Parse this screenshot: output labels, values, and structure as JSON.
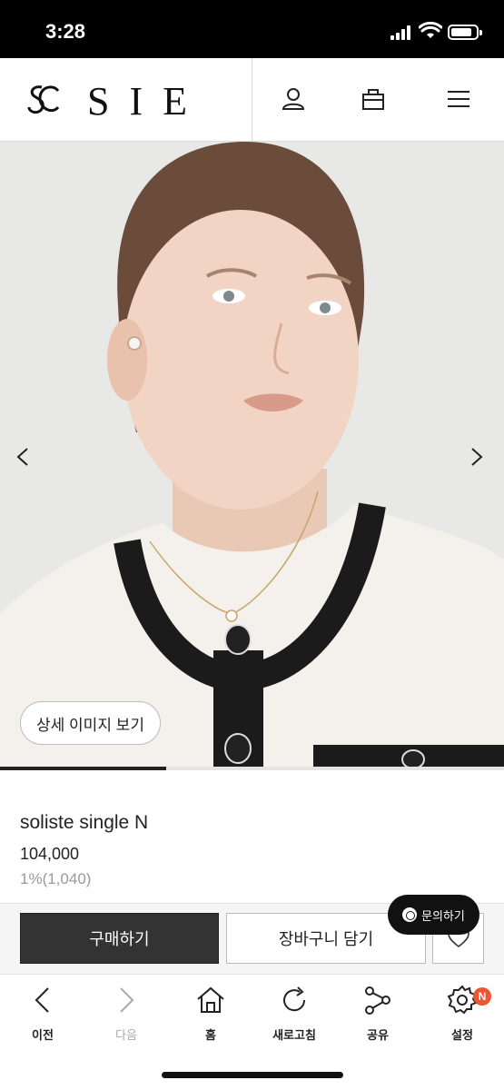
{
  "status_bar": {
    "time": "3:28"
  },
  "header": {
    "brand": "SIE",
    "icons": [
      "user-icon",
      "bag-icon",
      "menu-icon"
    ]
  },
  "hero": {
    "detail_button_label": "상세 이미지 보기",
    "prev_icon": "chevron-left-icon",
    "next_icon": "chevron-right-icon",
    "progress": 0.33
  },
  "product": {
    "name": "soliste single N",
    "price": "104,000",
    "points": "1%(1,040)"
  },
  "actions": {
    "buy_label": "구매하기",
    "cart_label": "장바구니 담기",
    "wish_icon": "heart-icon",
    "inquiry_label": "문의하기"
  },
  "bottom_nav": {
    "items": [
      {
        "label": "이전",
        "icon": "back-icon"
      },
      {
        "label": "다음",
        "icon": "forward-icon"
      },
      {
        "label": "홈",
        "icon": "home-icon"
      },
      {
        "label": "새로고침",
        "icon": "refresh-icon"
      },
      {
        "label": "공유",
        "icon": "share-icon"
      },
      {
        "label": "설정",
        "icon": "settings-icon",
        "badge": "N"
      }
    ]
  },
  "colors": {
    "primary_button": "#333333",
    "badge": "#ee5533"
  }
}
